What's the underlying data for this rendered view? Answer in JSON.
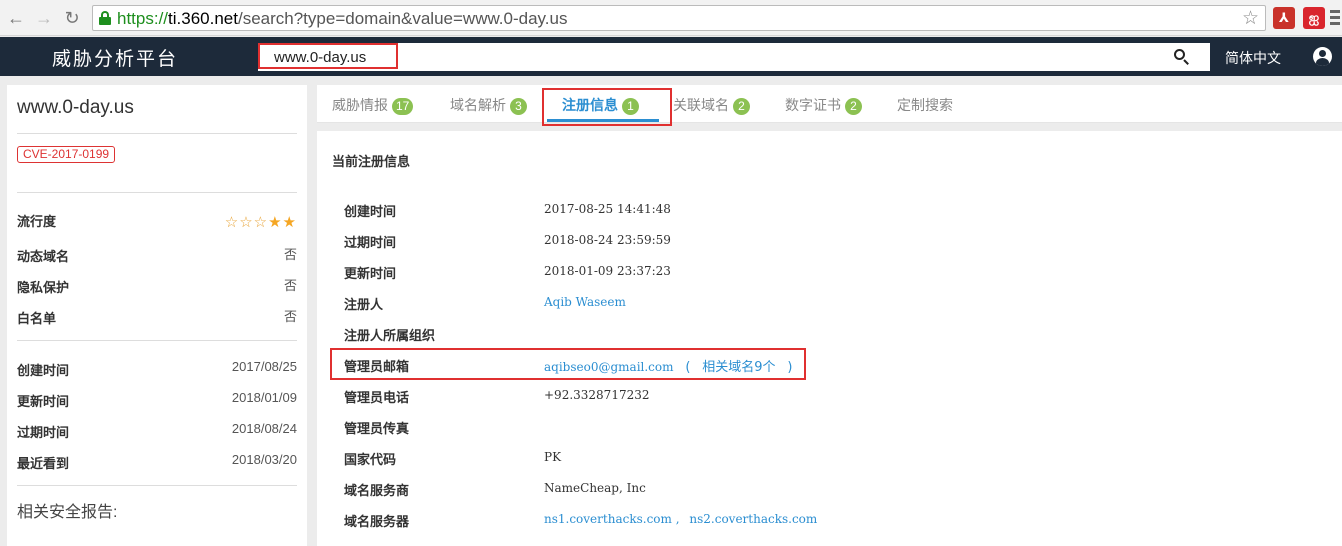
{
  "browser": {
    "back": "←",
    "forward": "→",
    "reload": "↻",
    "url_scheme": "https://",
    "url_host": "ti.360.net",
    "url_path": "/search?type=domain&value=www.0-day.us",
    "star": "☆",
    "extensions": [
      "pdf-icon",
      "red-app-icon"
    ]
  },
  "header": {
    "title": "威胁分析平台",
    "search_value": "www.0-day.us",
    "language": "简体中文"
  },
  "sidebar": {
    "domain": "www.0-day.us",
    "cve": "CVE-2017-0199",
    "popularity_label": "流行度",
    "popularity_stars": {
      "empty": 3,
      "filled": 2,
      "total": 5
    },
    "flags": [
      {
        "label": "动态域名",
        "value": "否"
      },
      {
        "label": "隐私保护",
        "value": "否"
      },
      {
        "label": "白名单",
        "value": "否"
      }
    ],
    "dates": [
      {
        "label": "创建时间",
        "value": "2017/08/25"
      },
      {
        "label": "更新时间",
        "value": "2018/01/09"
      },
      {
        "label": "过期时间",
        "value": "2018/08/24"
      },
      {
        "label": "最近看到",
        "value": "2018/03/20"
      }
    ],
    "reports_label": "相关安全报告:"
  },
  "tabs": [
    {
      "label": "威胁情报",
      "count": "17"
    },
    {
      "label": "域名解析",
      "count": "3"
    },
    {
      "label": "注册信息",
      "count": "1",
      "active": true
    },
    {
      "label": "关联域名",
      "count": "2"
    },
    {
      "label": "数字证书",
      "count": "2"
    },
    {
      "label": "定制搜索",
      "count": ""
    }
  ],
  "whois": {
    "section_title": "当前注册信息",
    "rows": [
      {
        "label": "创建时间",
        "value": "2017-08-25 14:41:48"
      },
      {
        "label": "过期时间",
        "value": "2018-08-24 23:59:59"
      },
      {
        "label": "更新时间",
        "value": "2018-01-09 23:37:23"
      },
      {
        "label": "注册人",
        "value": "Aqib Waseem"
      },
      {
        "label": "注册人所属组织",
        "value": ""
      },
      {
        "label": "管理员邮箱",
        "value": "aqibseo0@gmail.com",
        "related_prefix": "(",
        "related_text": "相关域名9个",
        "related_suffix": ")"
      },
      {
        "label": "管理员电话",
        "value": "+92.3328717232"
      },
      {
        "label": "管理员传真",
        "value": ""
      },
      {
        "label": "国家代码",
        "value": "PK"
      },
      {
        "label": "域名服务商",
        "value": "NameCheap, Inc"
      },
      {
        "label": "域名服务器",
        "value": "ns1.coverthacks.com",
        "value2": "ns2.coverthacks.com",
        "separator": ","
      }
    ]
  },
  "colors": {
    "header_bg": "#1d2a3a",
    "accent": "#2b8ed1",
    "badge_green": "#8cc152",
    "highlight_red": "#e03030"
  }
}
